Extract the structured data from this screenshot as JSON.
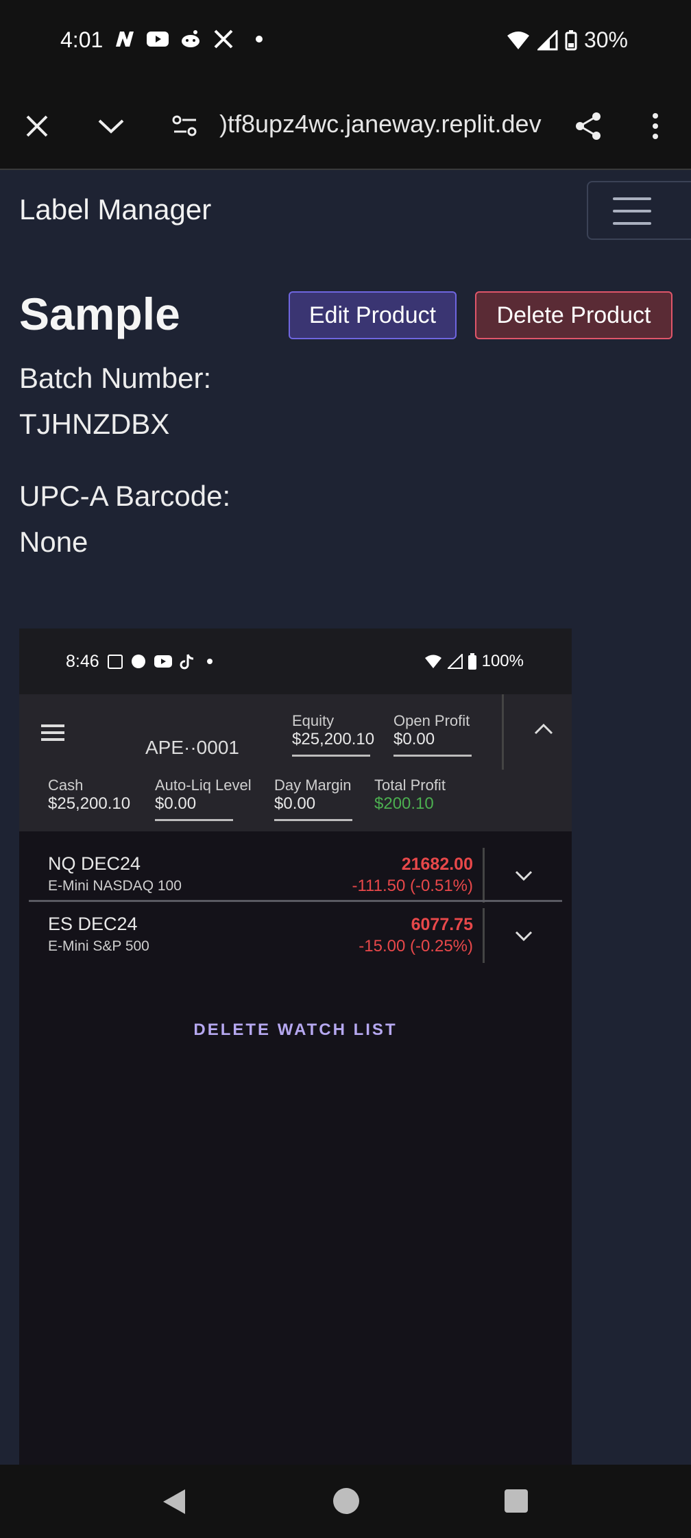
{
  "status_bar": {
    "time": "4:01",
    "battery": "30%"
  },
  "browser": {
    "url": ")tf8upz4wc.janeway.replit.dev"
  },
  "navbar": {
    "brand": "Label Manager"
  },
  "product": {
    "title": "Sample",
    "edit_label": "Edit Product",
    "delete_label": "Delete Product",
    "batch_label": "Batch Number:",
    "batch_value": "TJHNZDBX",
    "upc_label": "UPC-A Barcode:",
    "upc_value": "None"
  },
  "embedded": {
    "time": "8:46",
    "battery": "100%",
    "account": "APE··0001",
    "equity_label": "Equity",
    "equity_value": "$25,200.10",
    "open_profit_label": "Open Profit",
    "open_profit_value": "$0.00",
    "cash_label": "Cash",
    "cash_value": "$25,200.10",
    "autoliq_label": "Auto-Liq Level",
    "autoliq_value": "$0.00",
    "daymargin_label": "Day Margin",
    "daymargin_value": "$0.00",
    "totalprofit_label": "Total Profit",
    "totalprofit_value": "$200.10",
    "rows": [
      {
        "symbol": "NQ DEC24",
        "name": "E-Mini NASDAQ 100",
        "price": "21682.00",
        "change": "-111.50 (-0.51%)"
      },
      {
        "symbol": "ES DEC24",
        "name": "E-Mini S&P 500",
        "price": "6077.75",
        "change": "-15.00 (-0.25%)"
      }
    ],
    "delete_watchlist": "DELETE WATCH LIST"
  },
  "colors": {
    "positive": "#4caf50",
    "negative": "#e8484a",
    "accent": "#6f66e0"
  }
}
